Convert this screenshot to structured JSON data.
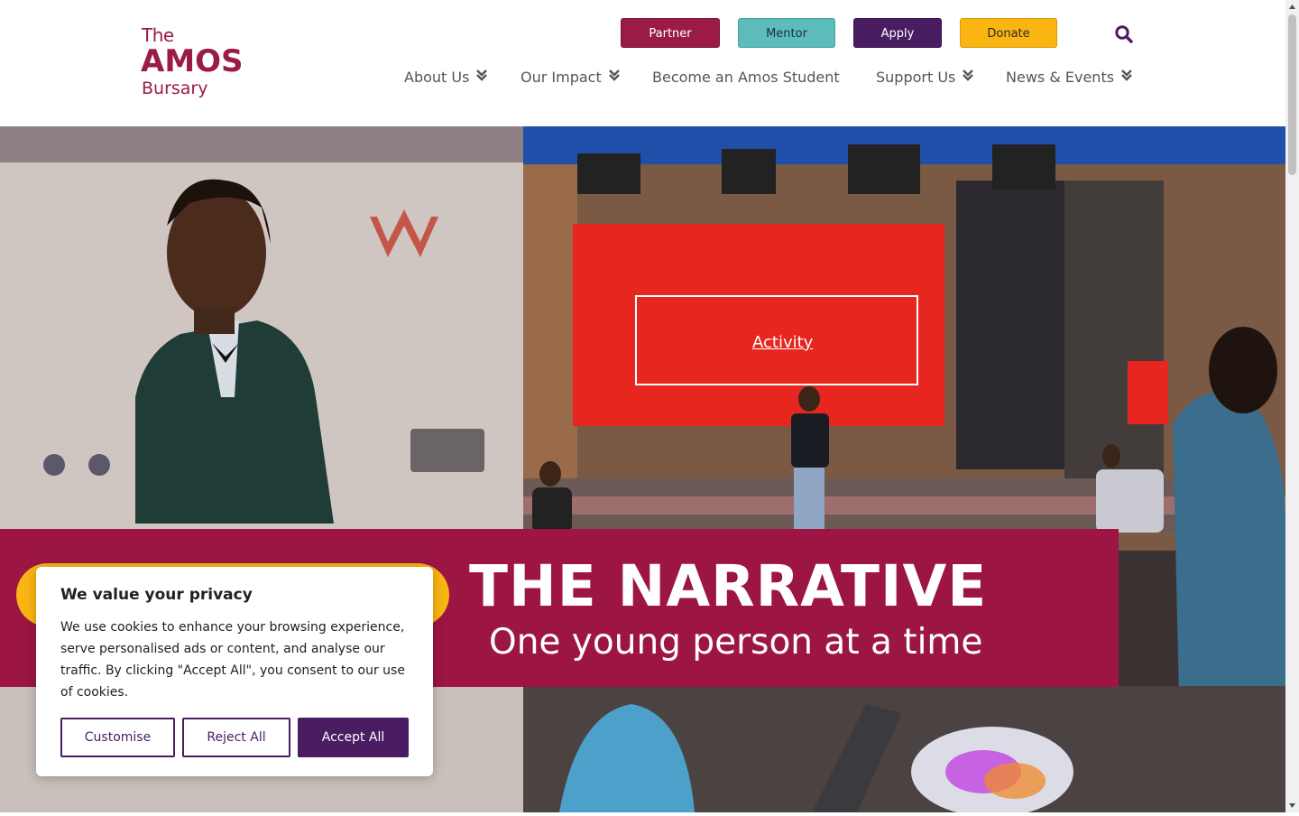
{
  "brand": {
    "logo_the": "The",
    "logo_amos": "AMOS",
    "logo_bursary": "Bursary",
    "primary_color": "#9b1b48",
    "purple_color": "#4a1d63",
    "teal_color": "#5bbcb9",
    "yellow_color": "#fbb512"
  },
  "header": {
    "cta_buttons": {
      "partner": "Partner",
      "mentor": "Mentor",
      "apply": "Apply",
      "donate": "Donate"
    },
    "search_icon": "search-icon",
    "nav": [
      {
        "label": "About Us",
        "has_dropdown": true
      },
      {
        "label": "Our Impact",
        "has_dropdown": true
      },
      {
        "label": "Become an Amos Student",
        "has_dropdown": false
      },
      {
        "label": "Support Us",
        "has_dropdown": true
      },
      {
        "label": "News & Events",
        "has_dropdown": true
      }
    ],
    "dropdown_icon": "double-chevron-down-icon"
  },
  "hero": {
    "title": "THE NARRATIVE",
    "subtitle": "One young person at a time",
    "screen_text": "Activity",
    "banner_color": "#9c1543"
  },
  "cookie_banner": {
    "title": "We value your privacy",
    "text": "We use cookies to enhance your browsing experience, serve personalised ads or content, and analyse our traffic. By clicking \"Accept All\", you consent to our use of cookies.",
    "customise": "Customise",
    "reject": "Reject All",
    "accept": "Accept All"
  }
}
